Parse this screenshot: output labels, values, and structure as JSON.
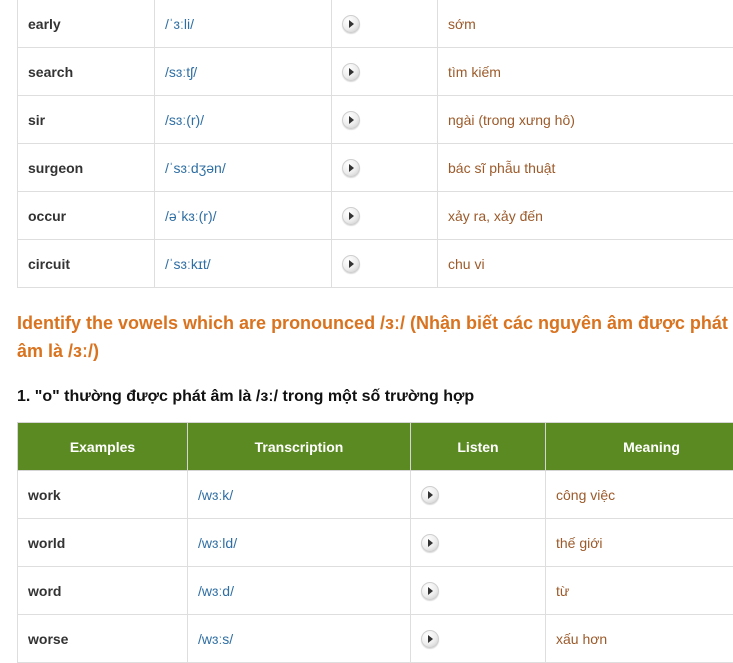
{
  "vocab_table": {
    "rows": [
      {
        "word": "early",
        "ipa": "/ˈɜːli/",
        "meaning": "sớm"
      },
      {
        "word": "search",
        "ipa": "/sɜːtʃ/",
        "meaning": "tìm kiếm"
      },
      {
        "word": "sir",
        "ipa": "/sɜː(r)/",
        "meaning": "ngài (trong xưng hô)"
      },
      {
        "word": "surgeon",
        "ipa": "/ˈsɜːdʒən/",
        "meaning": "bác sĩ phẫu thuật"
      },
      {
        "word": "occur",
        "ipa": "/əˈkɜː(r)/",
        "meaning": "xảy ra, xảy đến"
      },
      {
        "word": "circuit",
        "ipa": "/ˈsɜːkɪt/",
        "meaning": "chu vi"
      }
    ]
  },
  "section_heading": "Identify the vowels which are pronounced /ɜː/ (Nhận biết các nguyên âm được phát âm là /ɜː/)",
  "subheading": "1. \"o\" thường được phát âm là /ɜː/ trong một số trường hợp",
  "examples_table": {
    "headers": [
      "Examples",
      "Transcription",
      "Listen",
      "Meaning"
    ],
    "rows": [
      {
        "word": "work",
        "ipa": "/wɜːk/",
        "meaning": "công việc"
      },
      {
        "word": "world",
        "ipa": "/wɜːld/",
        "meaning": "thế giới"
      },
      {
        "word": "word",
        "ipa": "/wɜːd/",
        "meaning": "từ"
      },
      {
        "word": "worse",
        "ipa": "/wɜːs/",
        "meaning": "xấu hơn"
      }
    ]
  },
  "colors": {
    "header_bg": "#5b8a22",
    "heading": "#d9731f",
    "ipa": "#2e6ea3",
    "meaning": "#9c5a2a"
  },
  "icons": {
    "play": "play-audio-icon"
  }
}
